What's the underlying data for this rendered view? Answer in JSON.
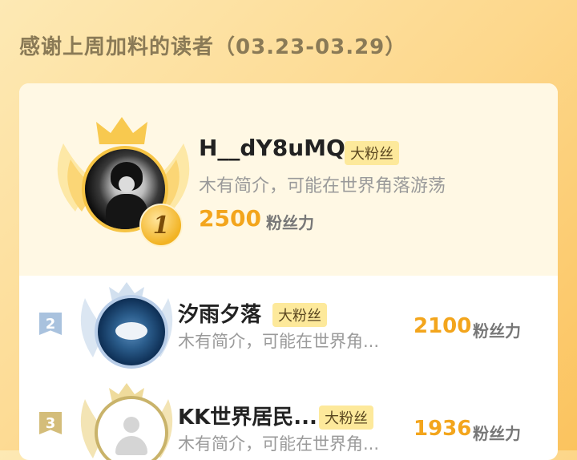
{
  "header": {
    "title": "感谢上周加料的读者（03.23-03.29）"
  },
  "colors": {
    "accent": "#f3a51c",
    "tag_bg": "#fde99b",
    "gold": "#f6c444",
    "silver": "#b8cde8",
    "bronze": "#c9b36a"
  },
  "top_reader": {
    "rank": "1",
    "name": "H__dY8uMQ",
    "tag": "大粉丝",
    "bio": "木有简介，可能在世界角落游荡",
    "score": "2500",
    "score_unit": "粉丝力"
  },
  "readers": [
    {
      "rank": "2",
      "name": "汐雨夕落",
      "tag": "大粉丝",
      "bio": "木有简介，可能在世界角...",
      "score": "2100",
      "score_unit": "粉丝力"
    },
    {
      "rank": "3",
      "name": "KK世界居民...",
      "tag": "大粉丝",
      "bio": "木有简介，可能在世界角...",
      "score": "1936",
      "score_unit": "粉丝力"
    }
  ],
  "icons": [
    "crown-icon",
    "wing-icon",
    "default-avatar-icon",
    "rank-flag-icon"
  ]
}
